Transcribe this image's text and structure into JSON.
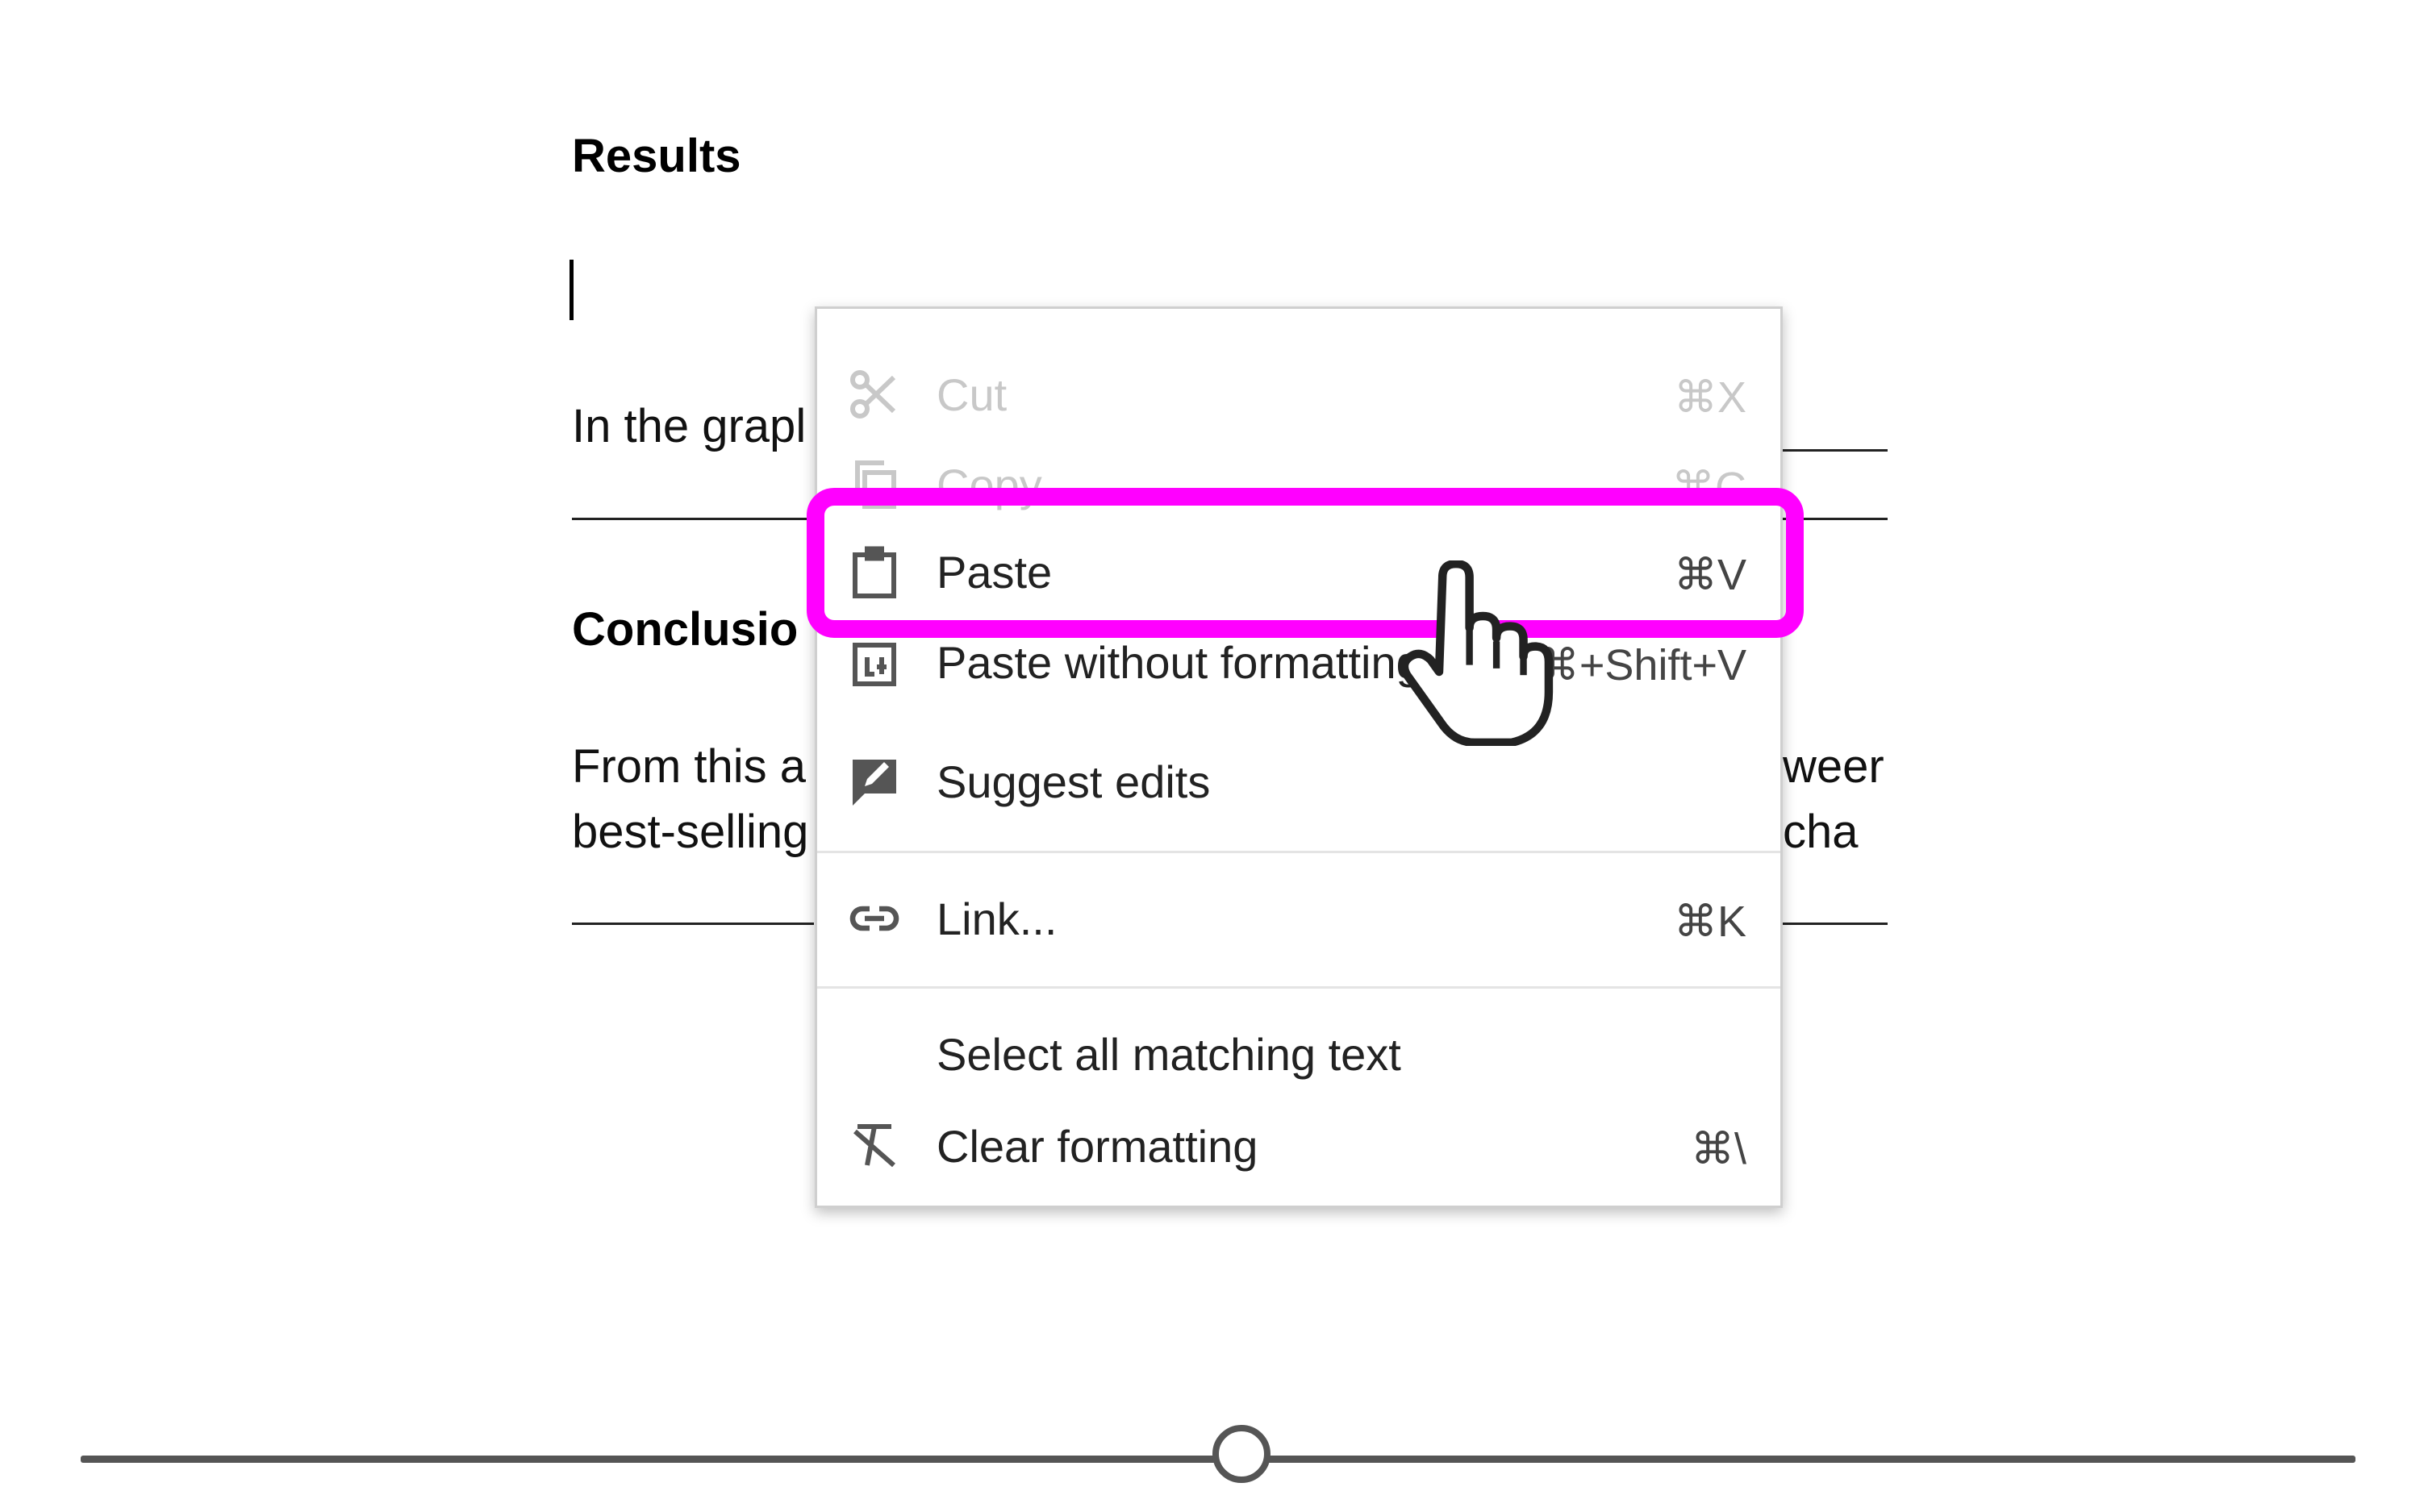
{
  "document": {
    "results_heading": "Results",
    "paragraph1_visible": "In the grapl",
    "conclusion_heading": "Conclusio",
    "paragraph2_line1_left": "From this a",
    "paragraph2_line1_right": "weer",
    "paragraph2_line2_left": "best-selling",
    "paragraph2_line2_right": "cha"
  },
  "context_menu": {
    "items": [
      {
        "label": "Cut",
        "shortcut": "⌘X",
        "icon": "scissors-icon",
        "enabled": false
      },
      {
        "label": "Copy",
        "shortcut": "⌘C",
        "icon": "copy-icon",
        "enabled": false
      },
      {
        "label": "Paste",
        "shortcut": "⌘V",
        "icon": "clipboard-icon",
        "enabled": true,
        "highlighted": true
      },
      {
        "label": "Paste without formatting",
        "shortcut": "⌘+Shift+V",
        "icon": "paste-plain-icon",
        "enabled": true
      },
      {
        "label": "Suggest edits",
        "shortcut": "",
        "icon": "suggest-edit-icon",
        "enabled": true
      },
      {
        "label": "Link...",
        "shortcut": "⌘K",
        "icon": "link-icon",
        "enabled": true
      },
      {
        "label": "Select all matching text",
        "shortcut": "",
        "icon": "",
        "enabled": true
      },
      {
        "label": "Clear formatting",
        "shortcut": "⌘\\",
        "icon": "clear-format-icon",
        "enabled": true
      }
    ]
  },
  "colors": {
    "highlight": "#ff00ff",
    "disabled_text": "#c8c8c8",
    "timeline": "#555555"
  }
}
